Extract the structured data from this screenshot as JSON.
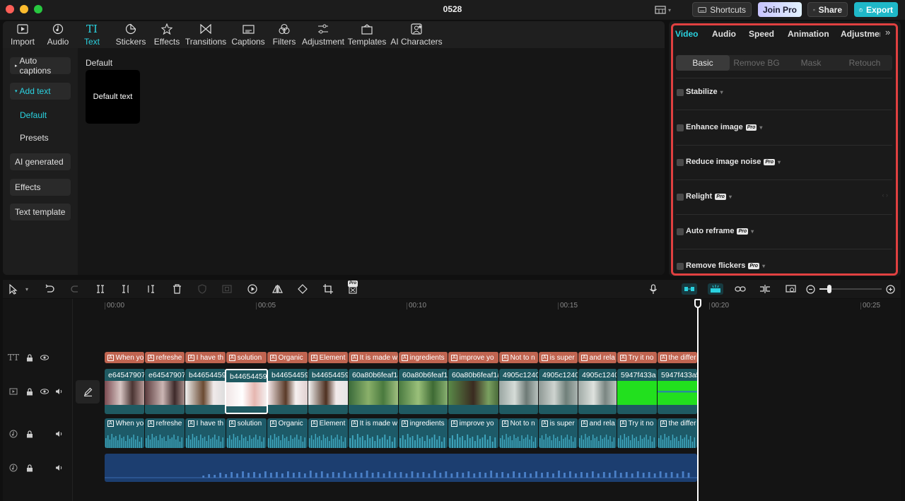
{
  "window": {
    "title": "0528"
  },
  "titlebar": {
    "shortcuts_label": "Shortcuts",
    "join_pro_label": "Join Pro",
    "share_label": "Share",
    "export_label": "Export"
  },
  "media_tabs": [
    {
      "label": "Import",
      "icon": "import-icon"
    },
    {
      "label": "Audio",
      "icon": "audio-icon"
    },
    {
      "label": "Text",
      "icon": "text-icon",
      "active": true
    },
    {
      "label": "Stickers",
      "icon": "stickers-icon"
    },
    {
      "label": "Effects",
      "icon": "effects-icon"
    },
    {
      "label": "Transitions",
      "icon": "transitions-icon"
    },
    {
      "label": "Captions",
      "icon": "captions-icon"
    },
    {
      "label": "Filters",
      "icon": "filters-icon"
    },
    {
      "label": "Adjustment",
      "icon": "adjustment-icon"
    },
    {
      "label": "Templates",
      "icon": "templates-icon"
    },
    {
      "label": "AI Characters",
      "icon": "ai-characters-icon"
    }
  ],
  "text_sidebar": {
    "auto_captions": "Auto captions",
    "add_text": "Add text",
    "default": "Default",
    "presets": "Presets",
    "ai_generated": "AI generated",
    "effects": "Effects",
    "text_template": "Text template"
  },
  "text_panel": {
    "section_title": "Default",
    "card_label": "Default text"
  },
  "inspector": {
    "tabs": [
      "Video",
      "Audio",
      "Speed",
      "Animation",
      "Adjustmen"
    ],
    "active_tab": "Video",
    "subtabs": [
      "Basic",
      "Remove BG",
      "Mask",
      "Retouch"
    ],
    "active_subtab": "Basic",
    "options": [
      {
        "label": "Stabilize",
        "pro": false
      },
      {
        "label": "Enhance image",
        "pro": true
      },
      {
        "label": "Reduce image noise",
        "pro": true
      },
      {
        "label": "Relight",
        "pro": true
      },
      {
        "label": "Auto reframe",
        "pro": true
      },
      {
        "label": "Remove flickers",
        "pro": true
      }
    ],
    "pro_badge": "Pro",
    "highlight_color": "#e04040"
  },
  "toolbar": {
    "pro_badge": "Pro"
  },
  "ruler": [
    "00:00",
    "00:05",
    "00:10",
    "00:15",
    "00:20",
    "00:25"
  ],
  "text_clips": [
    "When yo",
    "refreshe",
    "I have th",
    "solution",
    "Organic",
    "Element",
    "It is made w",
    "ingredients",
    "improve yo",
    "Not to n",
    "is super",
    "and rela",
    "Try it no",
    "the differ"
  ],
  "video_clips": [
    "e64547907",
    "e64547907",
    "b44654459",
    "b44654459",
    "b44654459",
    "b44654459",
    "60a80b6feaf1a",
    "60a80b6feaf1a",
    "60a80b6feaf1a",
    "4905c1240",
    "4905c1240",
    "4905c1240",
    "5947f433a",
    "5947f433a5"
  ],
  "audio_clips": [
    "When yo",
    "refreshe",
    "I have th",
    "solution",
    "Organic",
    "Element",
    "It is made w",
    "ingredients",
    "improve yo",
    "Not to n",
    "is super",
    "and rela",
    "Try it no",
    "the differ"
  ],
  "colors": {
    "accent": "#2ad2e0",
    "export": "#1fb8c8",
    "text_clip": "#c06450",
    "video_clip": "#1f5a62",
    "audio_clip": "#1d5a68",
    "bgm_clip": "#1c3e70"
  }
}
